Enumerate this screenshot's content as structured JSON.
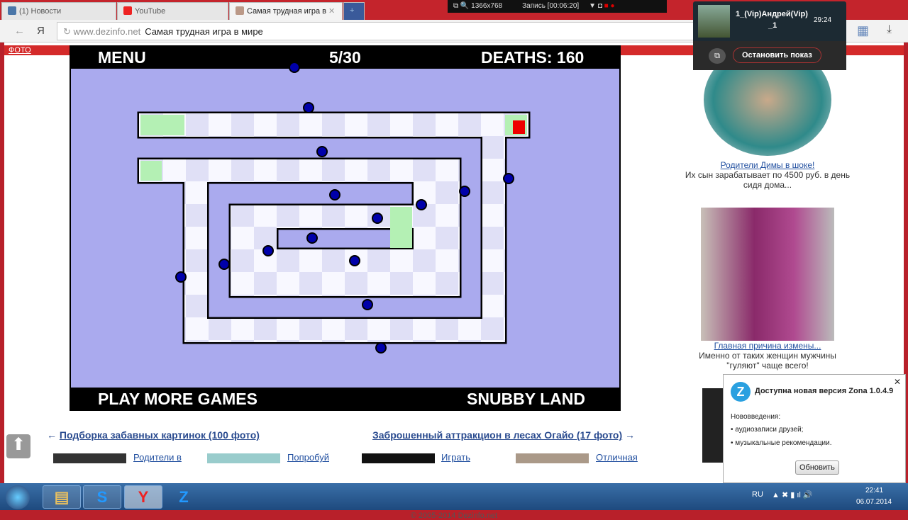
{
  "browser": {
    "tabs": [
      {
        "label": "(1) Новости"
      },
      {
        "label": "YouTube"
      },
      {
        "label": "Самая трудная игра в"
      }
    ],
    "url_host": "www.dezinfo.net",
    "url_title": "Самая трудная игра в мире",
    "yandex": "Я"
  },
  "recorder": {
    "resolution": "1366x768",
    "status": "Запись [00:06:20]"
  },
  "stream": {
    "user": "1_(Vip)Андрей(Vip)",
    "user2": "_1",
    "time": "29:24",
    "stop_label": "Остановить показ"
  },
  "site": {
    "foto": "ФОТО",
    "footer": "© 2005-2014 Dezinfo.net",
    "prev_link": "Подборка забавных картинок (100 фото)",
    "next_link": "Заброшенный аттракцион в лесах Огайо (17 фото)",
    "thumbs": [
      "Родители в",
      "Попробуй",
      "Играть",
      "Отличная"
    ]
  },
  "game": {
    "menu": "MENU",
    "level": "5/30",
    "deaths": "DEATHS: 160",
    "more_games": "PLAY MORE GAMES",
    "brand": "SNUBBY LAND",
    "colors": {
      "field": "#aaaaee",
      "safe": "#b4f0b4",
      "player": "#ee0000",
      "enemy": "#0000aa"
    }
  },
  "ads": [
    {
      "link": "Родители Димы в шоке!",
      "text": "Их сын зарабатывает по 4500 руб. в день сидя дома..."
    },
    {
      "link": "Главная причина измены...",
      "text": "Именно от таких женщин мужчины \"гуляют\" чаще всего!"
    }
  ],
  "notification": {
    "title": "Доступна новая версия Zona 1.0.4.9",
    "heading": "Нововведения:",
    "items": [
      "аудиозаписи друзей;",
      "музыкальные рекомендации."
    ],
    "button": "Обновить"
  },
  "taskbar": {
    "lang": "RU",
    "time": "22:41",
    "date": "06.07.2014"
  }
}
